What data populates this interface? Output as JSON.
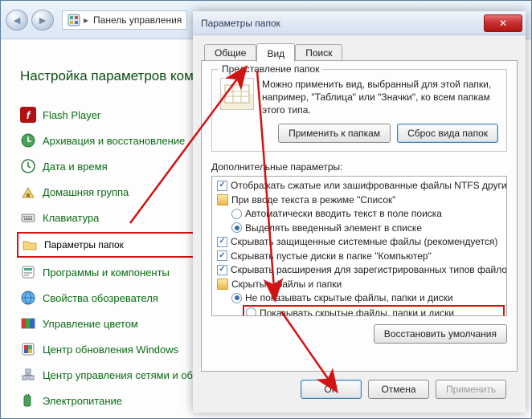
{
  "control_panel": {
    "breadcrumb_label": "Панель управления",
    "heading": "Настройка параметров компьютера",
    "items": [
      {
        "label": "Flash Player",
        "icon": "flash"
      },
      {
        "label": "Архивация и восстановление",
        "icon": "backup"
      },
      {
        "label": "Дата и время",
        "icon": "clock"
      },
      {
        "label": "Домашняя группа",
        "icon": "homegroup"
      },
      {
        "label": "Клавиатура",
        "icon": "keyboard"
      },
      {
        "label": "Параметры папок",
        "icon": "folder",
        "highlighted": true
      },
      {
        "label": "Программы и компоненты",
        "icon": "programs"
      },
      {
        "label": "Свойства обозревателя",
        "icon": "internet"
      },
      {
        "label": "Управление цветом",
        "icon": "color"
      },
      {
        "label": "Центр обновления Windows",
        "icon": "update"
      },
      {
        "label": "Центр управления сетями и общим доступом",
        "icon": "network"
      },
      {
        "label": "Электропитание",
        "icon": "power"
      }
    ]
  },
  "dialog": {
    "title": "Параметры папок",
    "tabs": {
      "general": "Общие",
      "view": "Вид",
      "search": "Поиск"
    },
    "active_tab": "view",
    "representation": {
      "legend": "Представление папок",
      "text": "Можно применить вид, выбранный для этой папки, например, \"Таблица\" или \"Значки\", ко всем папкам этого типа.",
      "apply_btn": "Применить к папкам",
      "reset_btn": "Сброс вида папок"
    },
    "tree": {
      "label": "Дополнительные параметры:",
      "rows": [
        {
          "kind": "check",
          "checked": true,
          "indent": 0,
          "text": "Отображать сжатые или зашифрованные файлы NTFS другим цветом"
        },
        {
          "kind": "folder",
          "indent": 0,
          "text": "При вводе текста в режиме \"Список\""
        },
        {
          "kind": "radio",
          "checked": false,
          "indent": 1,
          "text": "Автоматически вводить текст в поле поиска"
        },
        {
          "kind": "radio",
          "checked": true,
          "indent": 1,
          "text": "Выделять введенный элемент в списке"
        },
        {
          "kind": "check",
          "checked": true,
          "indent": 0,
          "text": "Скрывать защищенные системные файлы (рекомендуется)"
        },
        {
          "kind": "check",
          "checked": true,
          "indent": 0,
          "text": "Скрывать пустые диски в папке \"Компьютер\""
        },
        {
          "kind": "check",
          "checked": true,
          "indent": 0,
          "text": "Скрывать расширения для зарегистрированных типов файлов"
        },
        {
          "kind": "folder",
          "indent": 0,
          "text": "Скрытые файлы и папки"
        },
        {
          "kind": "radio",
          "checked": true,
          "indent": 1,
          "text": "Не показывать скрытые файлы, папки и диски"
        },
        {
          "kind": "radio",
          "checked": false,
          "indent": 1,
          "text": "Показывать скрытые файлы, папки и диски",
          "highlighted": true
        }
      ],
      "restore_btn": "Восстановить умолчания"
    },
    "buttons": {
      "ok": "OK",
      "cancel": "Отмена",
      "apply": "Применить"
    }
  }
}
